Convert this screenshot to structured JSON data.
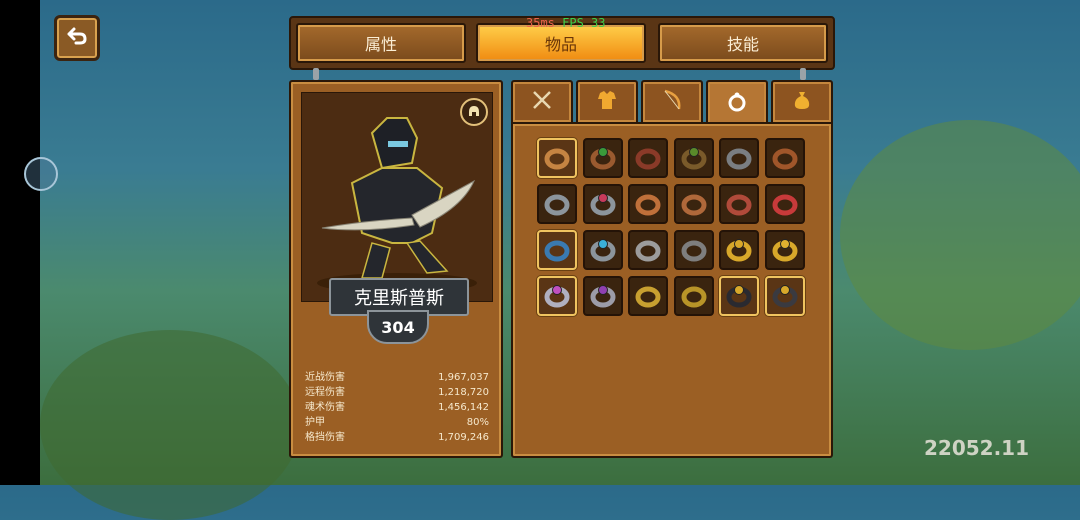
{
  "top_tabs": [
    {
      "label": "属性",
      "active": false
    },
    {
      "label": "物品",
      "active": true
    },
    {
      "label": "技能",
      "active": false
    }
  ],
  "debug": {
    "ping": "35ms",
    "fps": "FPS 33"
  },
  "side_indicator": "222",
  "character": {
    "name": "克里斯普斯",
    "level": "304",
    "stats": [
      {
        "label": "近战伤害",
        "value": "1,967,037"
      },
      {
        "label": "远程伤害",
        "value": "1,218,720"
      },
      {
        "label": "魂术伤害",
        "value": "1,456,142"
      },
      {
        "label": "护甲",
        "value": "80%"
      },
      {
        "label": "格挡伤害",
        "value": "1,709,246"
      }
    ]
  },
  "category_tabs": [
    {
      "icon": "swords-icon",
      "active": false
    },
    {
      "icon": "armor-icon",
      "active": false
    },
    {
      "icon": "bow-icon",
      "active": false
    },
    {
      "icon": "ring-icon",
      "active": true
    },
    {
      "icon": "pouch-icon",
      "active": false
    }
  ],
  "rings": [
    {
      "band": "#c58442",
      "gem": null,
      "selected": true
    },
    {
      "band": "#9a5a2f",
      "gem": "#3a9a3a",
      "selected": false
    },
    {
      "band": "#8a3a28",
      "gem": null,
      "selected": false
    },
    {
      "band": "#7a5a2a",
      "gem": "#5a8a2a",
      "selected": false
    },
    {
      "band": "#7a7e82",
      "gem": null,
      "selected": false
    },
    {
      "band": "#a0562a",
      "gem": null,
      "selected": false
    },
    {
      "band": "#8c959c",
      "gem": null,
      "selected": false
    },
    {
      "band": "#8c959c",
      "gem": "#c83a5a",
      "selected": false
    },
    {
      "band": "#c0703a",
      "gem": null,
      "selected": false
    },
    {
      "band": "#b0683a",
      "gem": null,
      "selected": false
    },
    {
      "band": "#b04a3a",
      "gem": null,
      "selected": false
    },
    {
      "band": "#c83a3a",
      "gem": null,
      "selected": false
    },
    {
      "band": "#3a7ab0",
      "gem": null,
      "selected": true
    },
    {
      "band": "#8c959c",
      "gem": "#3ab0d8",
      "selected": false
    },
    {
      "band": "#9c9c9c",
      "gem": null,
      "selected": false
    },
    {
      "band": "#7e7e7e",
      "gem": null,
      "selected": false
    },
    {
      "band": "#d8a82a",
      "gem": "#d8a82a",
      "selected": false
    },
    {
      "band": "#d8a82a",
      "gem": "#e0b030",
      "selected": false
    },
    {
      "band": "#b0b0c0",
      "gem": "#c050c0",
      "selected": true
    },
    {
      "band": "#9c9ca8",
      "gem": "#9040b0",
      "selected": false
    },
    {
      "band": "#c8a030",
      "gem": null,
      "selected": false
    },
    {
      "band": "#b89428",
      "gem": null,
      "selected": false
    },
    {
      "band": "#2a2a30",
      "gem": "#d8a82a",
      "selected": true
    },
    {
      "band": "#3a3a40",
      "gem": "#d8a82a",
      "selected": true
    }
  ],
  "gold_readout": "22052.11"
}
